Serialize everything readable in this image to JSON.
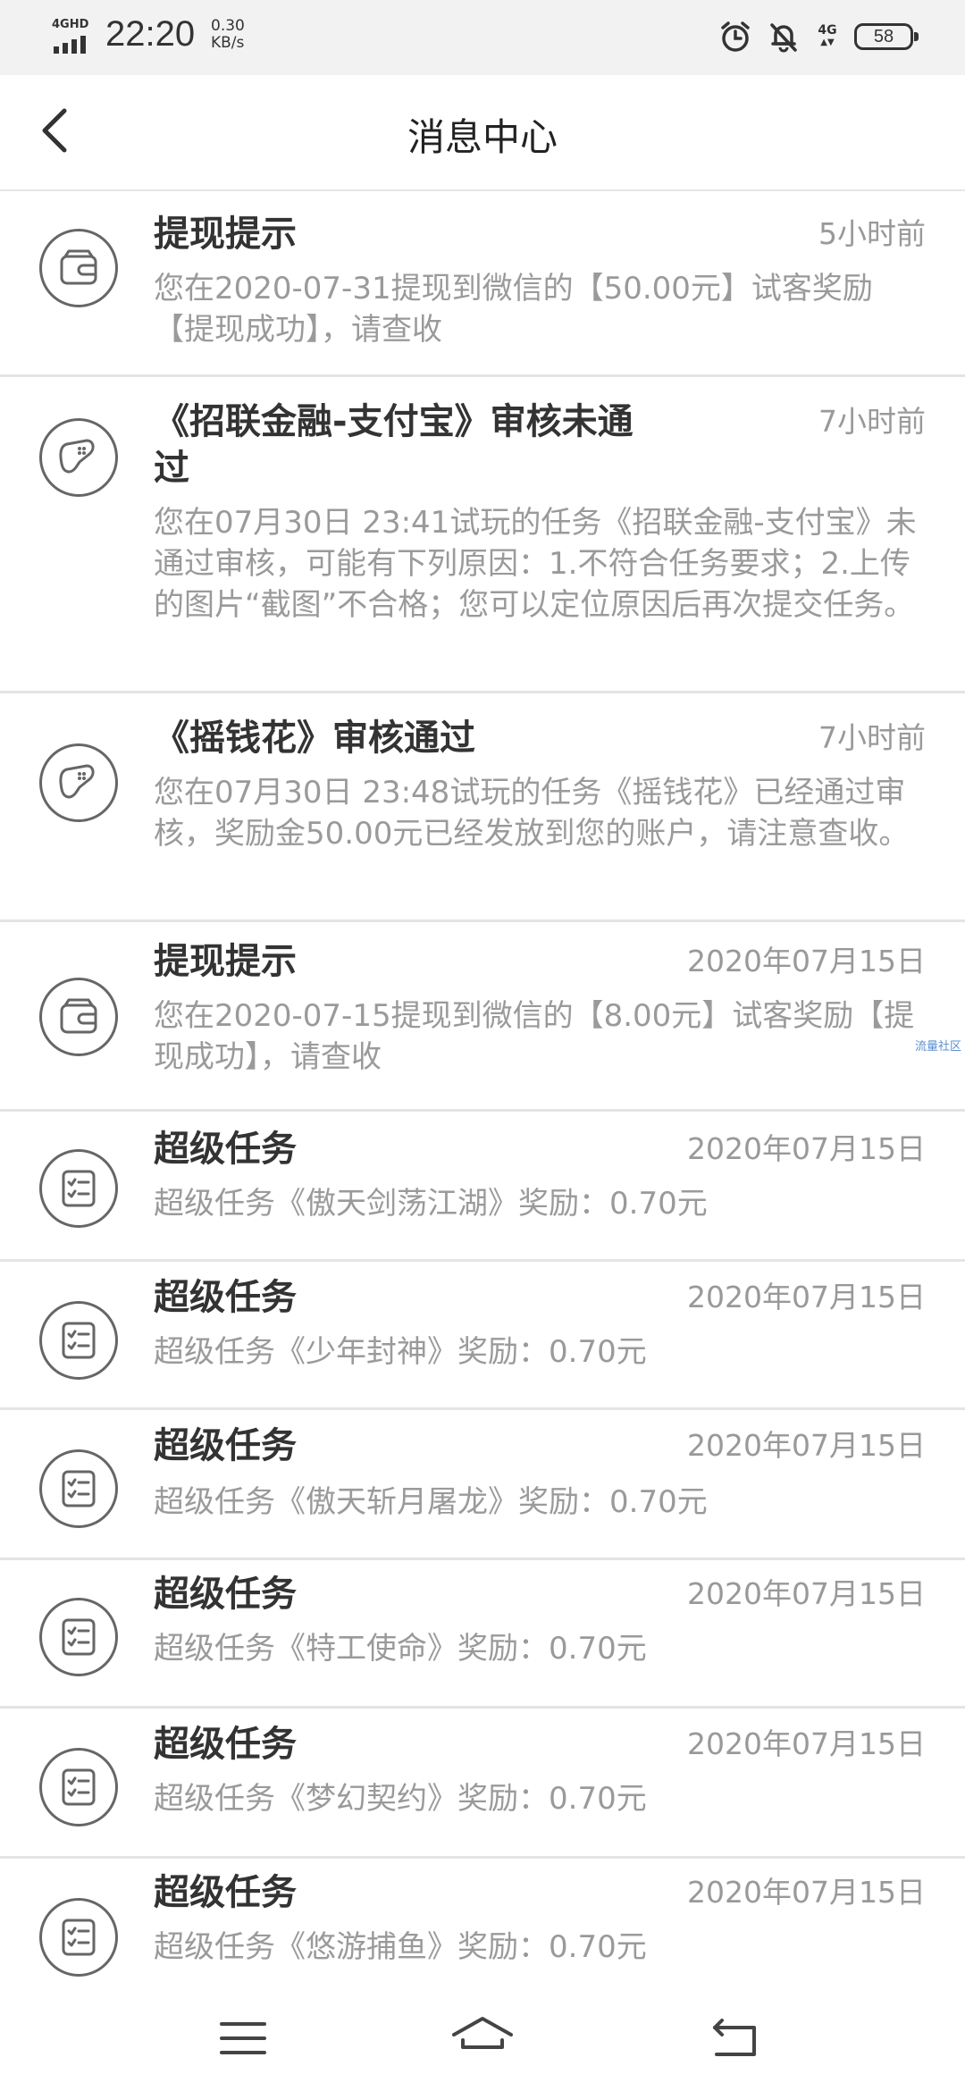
{
  "status_bar": {
    "network_label": "4GHD",
    "time": "22:20",
    "speed_value": "0.30",
    "speed_unit": "KB/s",
    "network_right": "4G",
    "battery": "58"
  },
  "nav": {
    "title": "消息中心"
  },
  "messages": [
    {
      "icon": "wallet-icon",
      "title": "提现提示",
      "time": "5小时前",
      "body": "您在2020-07-31提现到微信的【50.00元】试客奖励【提现成功】，请查收"
    },
    {
      "icon": "gamepad-icon",
      "title": "《招联金融-支付宝》审核未通过",
      "time": "7小时前",
      "body": "您在07月30日 23:41试玩的任务《招联金融-支付宝》未通过审核，可能有下列原因：1.不符合任务要求；2.上传的图片“截图”不合格；您可以定位原因后再次提交任务。"
    },
    {
      "icon": "gamepad-icon",
      "title": "《摇钱花》审核通过",
      "time": "7小时前",
      "body": "您在07月30日 23:48试玩的任务《摇钱花》已经通过审核，奖励金50.00元已经发放到您的账户，请注意查收。"
    },
    {
      "icon": "wallet-icon",
      "title": "提现提示",
      "time": "2020年07月15日",
      "body": "您在2020-07-15提现到微信的【8.00元】试客奖励【提现成功】，请查收"
    },
    {
      "icon": "checklist-icon",
      "title": "超级任务",
      "time": "2020年07月15日",
      "body": "超级任务《傲天剑荡江湖》奖励：0.70元"
    },
    {
      "icon": "checklist-icon",
      "title": "超级任务",
      "time": "2020年07月15日",
      "body": "超级任务《少年封神》奖励：0.70元"
    },
    {
      "icon": "checklist-icon",
      "title": "超级任务",
      "time": "2020年07月15日",
      "body": "超级任务《傲天斩月屠龙》奖励：0.70元"
    },
    {
      "icon": "checklist-icon",
      "title": "超级任务",
      "time": "2020年07月15日",
      "body": "超级任务《特工使命》奖励：0.70元"
    },
    {
      "icon": "checklist-icon",
      "title": "超级任务",
      "time": "2020年07月15日",
      "body": "超级任务《梦幻契约》奖励：0.70元"
    },
    {
      "icon": "checklist-icon",
      "title": "超级任务",
      "time": "2020年07月15日",
      "body": "超级任务《悠游捕鱼》奖励：0.70元"
    }
  ],
  "watermark": "流量社区"
}
